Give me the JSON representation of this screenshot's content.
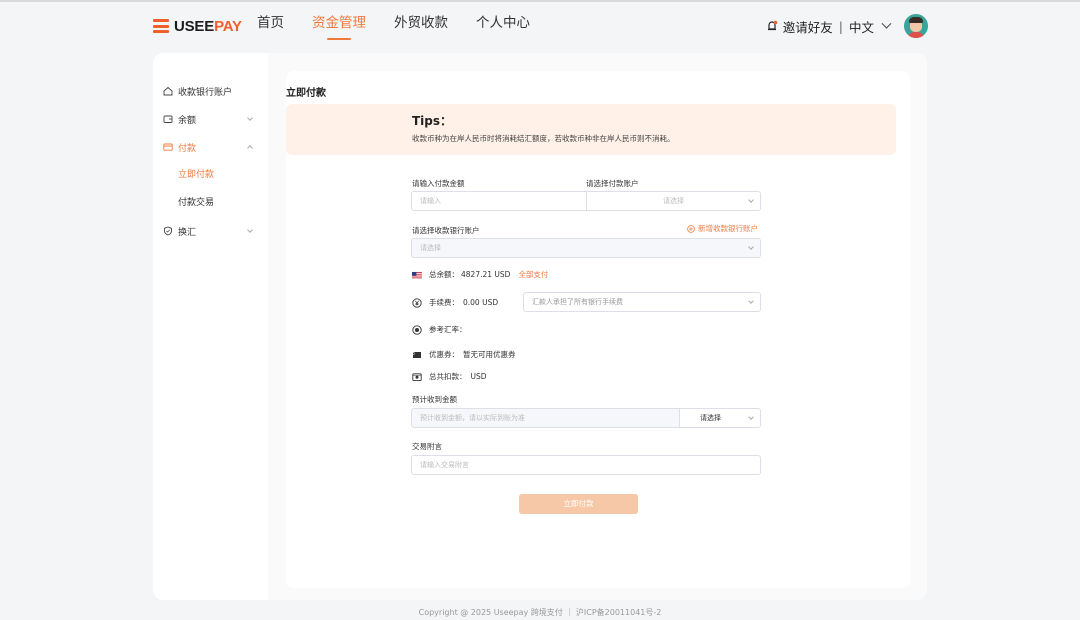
{
  "brand": {
    "logo_main": "USEE",
    "logo_accent": "PAY",
    "accent_color": "#f0602b"
  },
  "nav": {
    "items": [
      {
        "label": "首页"
      },
      {
        "label": "资金管理"
      },
      {
        "label": "外贸收款"
      },
      {
        "label": "个人中心"
      }
    ],
    "active": "资金管理"
  },
  "header": {
    "invite_label": "邀请好友",
    "separator": "|",
    "language": "中文"
  },
  "sidebar": {
    "items": [
      {
        "label": "收款银行账户"
      },
      {
        "label": "余额"
      },
      {
        "label": "付款"
      },
      {
        "label": "换汇"
      }
    ],
    "sub_items": [
      {
        "label": "立即付款"
      },
      {
        "label": "付款交易"
      }
    ]
  },
  "page": {
    "title": "立即付款"
  },
  "tips": {
    "title": "Tips：",
    "text": "收款币种为在岸人民币时将消耗结汇额度，若收款币种非在岸人民币则不消耗。"
  },
  "form": {
    "amount_label": "请输入付款金额",
    "amount_placeholder": "请输入",
    "account_label": "请选择付款账户",
    "account_placeholder": "请选择",
    "bank_label": "请选择收款银行账户",
    "add_bank_link": "新增收款银行账户",
    "bank_placeholder": "请选择",
    "balance_label": "总余额：",
    "balance_value": "4827.21 USD",
    "pay_all_link": "全部支付",
    "fee_label": "手续费：",
    "fee_value": "0.00 USD",
    "fee_option": "汇款人承担了所有银行手续费",
    "rate_label": "参考汇率：",
    "coupon_label": "优惠券：",
    "coupon_value": "暂无可用优惠券",
    "total_label": "总共扣款：",
    "total_value": "USD",
    "receive_label": "预计收到金额",
    "receive_placeholder": "预计收到金额，请以实际到账为准",
    "receive_select": "请选择",
    "memo_label": "交易附言",
    "memo_placeholder": "请输入交易附言",
    "submit_label": "立即付款"
  },
  "footer": {
    "text": "Copyright @ 2025 Useepay 跨境支付 ｜ 沪ICP备20011041号-2"
  }
}
